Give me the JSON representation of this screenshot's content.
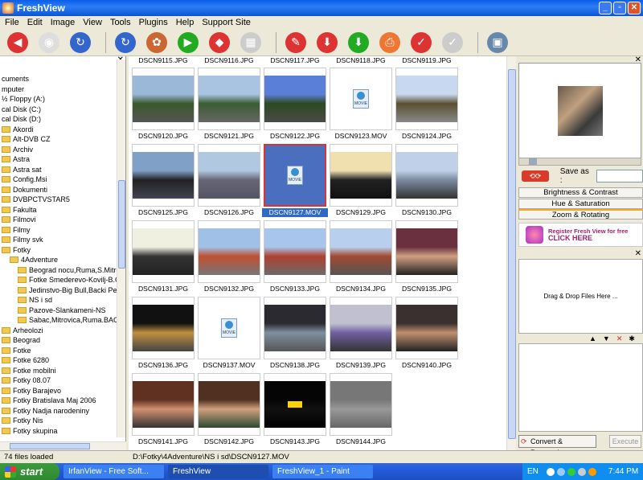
{
  "window": {
    "title": "FreshView"
  },
  "menu": [
    "File",
    "Edit",
    "Image",
    "View",
    "Tools",
    "Plugins",
    "Help",
    "Support Site"
  ],
  "toolbar": {
    "icons": [
      "back-icon",
      "home-icon",
      "forward-icon",
      "refresh-icon",
      "browse-icon",
      "slideshow-icon",
      "rotate-icon",
      "sheet-icon",
      "edit-icon",
      "download-icon",
      "upload-icon",
      "print-icon",
      "check-icon",
      "checkmark-icon",
      "wallpaper-icon"
    ]
  },
  "tree": [
    {
      "label": "cuments",
      "indent": 0,
      "folder": false
    },
    {
      "label": "mputer",
      "indent": 0,
      "folder": false
    },
    {
      "label": "½ Floppy (A:)",
      "indent": 0,
      "folder": false
    },
    {
      "label": "cal Disk (C:)",
      "indent": 0,
      "folder": false
    },
    {
      "label": "cal Disk (D:)",
      "indent": 0,
      "folder": false
    },
    {
      "label": "Akordi",
      "indent": 0,
      "folder": true
    },
    {
      "label": "Alt-DVB CZ",
      "indent": 0,
      "folder": true
    },
    {
      "label": "Archiv",
      "indent": 0,
      "folder": true
    },
    {
      "label": "Astra",
      "indent": 0,
      "folder": true
    },
    {
      "label": "Astra sat",
      "indent": 0,
      "folder": true
    },
    {
      "label": "Config.Msi",
      "indent": 0,
      "folder": true
    },
    {
      "label": "Dokumenti",
      "indent": 0,
      "folder": true
    },
    {
      "label": "DVBPCTVSTAR5",
      "indent": 0,
      "folder": true
    },
    {
      "label": "Fakulta",
      "indent": 0,
      "folder": true
    },
    {
      "label": "Filmovi",
      "indent": 0,
      "folder": true
    },
    {
      "label": "Filmy",
      "indent": 0,
      "folder": true
    },
    {
      "label": "Filmy svk",
      "indent": 0,
      "folder": true
    },
    {
      "label": "Fotky",
      "indent": 0,
      "folder": true
    },
    {
      "label": "4Adventure",
      "indent": 1,
      "folder": true
    },
    {
      "label": "Beograd nocu,Ruma,S.Mitro",
      "indent": 2,
      "folder": true
    },
    {
      "label": "Fotke Smederevo-Kovilj-B.C",
      "indent": 2,
      "folder": true
    },
    {
      "label": "Jedinstvo-Big Bull,Backi Petr",
      "indent": 2,
      "folder": true
    },
    {
      "label": "NS i sd",
      "indent": 2,
      "folder": true
    },
    {
      "label": "Pazove-Slankameni-NS",
      "indent": 2,
      "folder": true
    },
    {
      "label": "Sabac,Mitrovica,Ruma.BACI",
      "indent": 2,
      "folder": true
    },
    {
      "label": "Arheolozi",
      "indent": 0,
      "folder": true
    },
    {
      "label": "Beograd",
      "indent": 0,
      "folder": true
    },
    {
      "label": "Fotke",
      "indent": 0,
      "folder": true
    },
    {
      "label": "Fotke 6280",
      "indent": 0,
      "folder": true
    },
    {
      "label": "Fotke mobilni",
      "indent": 0,
      "folder": true
    },
    {
      "label": "Fotky 08.07",
      "indent": 0,
      "folder": true
    },
    {
      "label": "Fotky Barajevo",
      "indent": 0,
      "folder": true
    },
    {
      "label": "Fotky Bratislava Maj 2006",
      "indent": 0,
      "folder": true
    },
    {
      "label": "Fotky Nadja narodeniny",
      "indent": 0,
      "folder": true
    },
    {
      "label": "Fotky Nis",
      "indent": 0,
      "folder": true
    },
    {
      "label": "Fotky skupina",
      "indent": 0,
      "folder": true
    }
  ],
  "top_captions": [
    "DSCN9115.JPG",
    "DSCN9116.JPG",
    "DSCN9117.JPG",
    "DSCN9118.JPG",
    "DSCN9119.JPG"
  ],
  "files": [
    {
      "name": "DSCN9120.JPG",
      "kind": "photo",
      "c1": "#9ab8d8",
      "c2": "#3a5a2a",
      "c3": "#555"
    },
    {
      "name": "DSCN9121.JPG",
      "kind": "photo",
      "c1": "#a8c4e0",
      "c2": "#3b5d30",
      "c3": "#666"
    },
    {
      "name": "DSCN9122.JPG",
      "kind": "photo",
      "c1": "#5a7fd8",
      "c2": "#2c4a20",
      "c3": "#4a4a4a"
    },
    {
      "name": "DSCN9123.MOV",
      "kind": "movie"
    },
    {
      "name": "DSCN9124.JPG",
      "kind": "photo",
      "c1": "#c8d8f0",
      "c2": "#5a5030",
      "c3": "#888"
    },
    {
      "name": "DSCN9125.JPG",
      "kind": "photo",
      "c1": "#80a0c8",
      "c2": "#222",
      "c3": "#445"
    },
    {
      "name": "DSCN9126.JPG",
      "kind": "photo",
      "c1": "#b0c8e0",
      "c2": "#667",
      "c3": "#556"
    },
    {
      "name": "DSCN9127.MOV",
      "kind": "movie",
      "selected": true
    },
    {
      "name": "DSCN9129.JPG",
      "kind": "photo",
      "c1": "#f0e0b0",
      "c2": "#222",
      "c3": "#111"
    },
    {
      "name": "DSCN9130.JPG",
      "kind": "photo",
      "c1": "#c0d0e8",
      "c2": "#7a8aa0",
      "c3": "#333"
    },
    {
      "name": "DSCN9131.JPG",
      "kind": "photo",
      "c1": "#f0f0e0",
      "c2": "#333",
      "c3": "#222"
    },
    {
      "name": "DSCN9132.JPG",
      "kind": "photo",
      "c1": "#a0c0e8",
      "c2": "#c05030",
      "c3": "#777"
    },
    {
      "name": "DSCN9133.JPG",
      "kind": "photo",
      "c1": "#a8c6ec",
      "c2": "#b04030",
      "c3": "#6a6a6a"
    },
    {
      "name": "DSCN9134.JPG",
      "kind": "photo",
      "c1": "#b8d0ee",
      "c2": "#a04a30",
      "c3": "#555"
    },
    {
      "name": "DSCN9135.JPG",
      "kind": "photo",
      "c1": "#6a3040",
      "c2": "#d0a080",
      "c3": "#222"
    },
    {
      "name": "DSCN9136.JPG",
      "kind": "photo",
      "c1": "#111",
      "c2": "#c09040",
      "c3": "#444"
    },
    {
      "name": "DSCN9137.MOV",
      "kind": "movie"
    },
    {
      "name": "DSCN9138.JPG",
      "kind": "photo",
      "c1": "#2a2a30",
      "c2": "#8090a0",
      "c3": "#555"
    },
    {
      "name": "DSCN9139.JPG",
      "kind": "photo",
      "c1": "#c0c0d0",
      "c2": "#7060a0",
      "c3": "#333"
    },
    {
      "name": "DSCN9140.JPG",
      "kind": "photo",
      "c1": "#3a3030",
      "c2": "#c09070",
      "c3": "#222"
    },
    {
      "name": "DSCN9141.JPG",
      "kind": "photo",
      "c1": "#603020",
      "c2": "#d09070",
      "c3": "#333"
    },
    {
      "name": "DSCN9142.JPG",
      "kind": "photo",
      "c1": "#503020",
      "c2": "#d0a080",
      "c3": "#2a4a30"
    },
    {
      "name": "DSCN9143.JPG",
      "kind": "photo",
      "c1": "#050505",
      "c2": "#111",
      "c3": "#000",
      "sign": true
    },
    {
      "name": "DSCN9144.JPG",
      "kind": "photo",
      "c1": "#777",
      "c2": "#999",
      "c3": "#666"
    }
  ],
  "right": {
    "save_label": "Save as :",
    "buttons": [
      "Brightness & Contrast",
      "Hue & Saturation",
      "Zoom & Rotating"
    ],
    "banner_line1": "Register Fresh View for free",
    "banner_line2": "CLICK HERE",
    "drag_text": "Drag & Drop Files Here ...",
    "convert_label": "Convert & Resample",
    "execute_label": "Execute"
  },
  "status": {
    "left": "74 files loaded",
    "path": "D:\\Fotky\\4Adventure\\NS i sd\\DSCN9127.MOV"
  },
  "taskbar": {
    "start": "start",
    "tasks": [
      "IrfanView - Free Soft...",
      "FreshView",
      "FreshView_1 - Paint"
    ],
    "active_task": 1,
    "lang": "EN",
    "clock": "7:44 PM"
  }
}
